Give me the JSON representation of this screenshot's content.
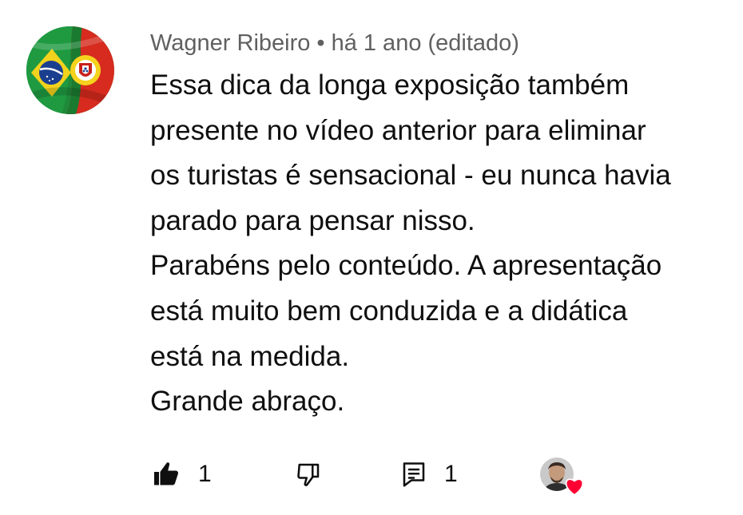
{
  "comment": {
    "author": "Wagner Ribeiro",
    "separator": "•",
    "timestamp": "há 1 ano (editado)",
    "lines": [
      "Essa dica da longa exposição também",
      "presente no vídeo anterior para eliminar",
      "os turistas é sensacional - eu nunca havia",
      "parado para pensar nisso.",
      "Parabéns pelo conteúdo. A apresentação",
      "está muito bem conduzida e a didática",
      "está na medida.",
      "Grande abraço."
    ],
    "likes": "1",
    "replies": "1"
  },
  "icons": {
    "avatar": "flags-avatar",
    "like": "thumbs-up-filled-icon",
    "dislike": "thumbs-down-outline-icon",
    "reply": "comment-icon",
    "creator_heart": "creator-heart-icon"
  },
  "colors": {
    "text": "#0f0f0f",
    "meta": "#606060",
    "heart": "#ff0033"
  }
}
